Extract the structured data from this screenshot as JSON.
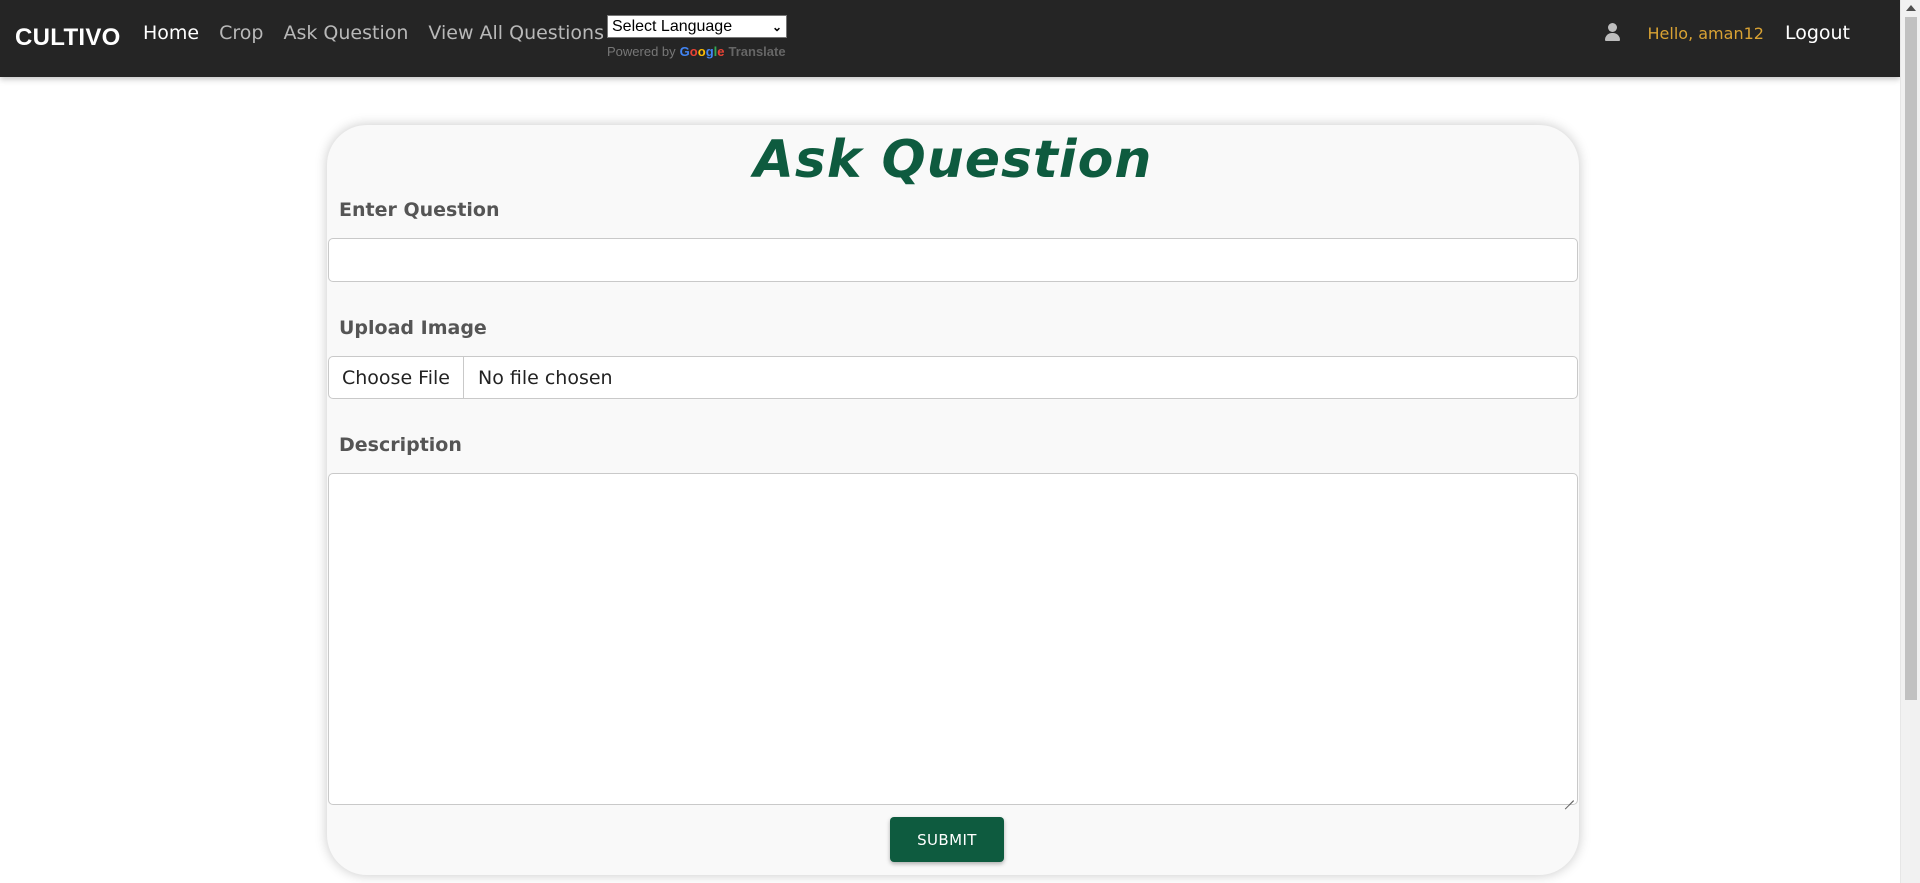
{
  "navbar": {
    "brand": "CULTIVO",
    "links": [
      {
        "label": "Home",
        "active": true
      },
      {
        "label": "Crop",
        "active": false
      },
      {
        "label": "Ask Question",
        "active": false
      },
      {
        "label": "View All Questions",
        "active": false
      }
    ],
    "translate": {
      "selected": "Select Language",
      "powered_by": "Powered by",
      "google": "Google",
      "translate_word": "Translate"
    },
    "user_icon": "user-icon",
    "greeting": "Hello, aman12",
    "logout": "Logout"
  },
  "form": {
    "title": "Ask Question",
    "question_label": "Enter Question",
    "question_value": "",
    "image_label": "Upload Image",
    "choose_file": "Choose File",
    "file_status": "No file chosen",
    "description_label": "Description",
    "description_value": "",
    "submit": "SUBMIT"
  },
  "colors": {
    "navbar_bg": "#252525",
    "accent_green": "#0e5b3f",
    "greeting": "#d9a233"
  }
}
